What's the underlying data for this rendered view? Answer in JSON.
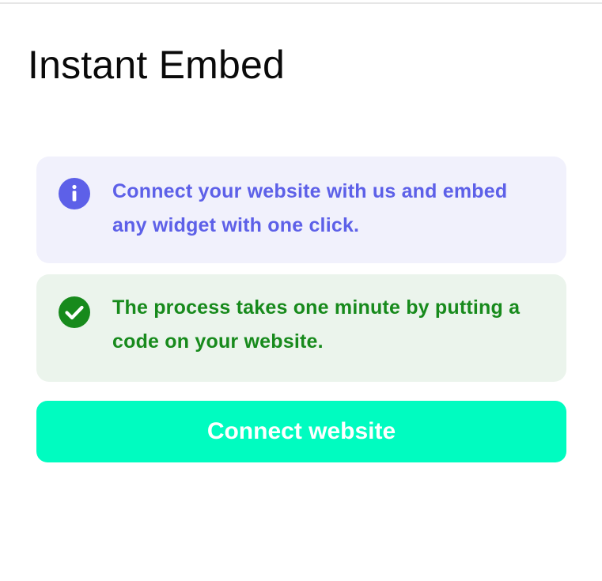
{
  "page": {
    "title": "Instant Embed"
  },
  "notices": {
    "info": {
      "icon": "info-icon",
      "color": "#5d60e8",
      "background": "#f1f1fc",
      "text": "Connect your website with us and embed any widget with one click."
    },
    "success": {
      "icon": "check-circle-icon",
      "color": "#178a1c",
      "background": "#ebf4ec",
      "text": "The process takes one minute by putting a code on your website."
    }
  },
  "actions": {
    "connect_label": "Connect website",
    "connect_color": "#00fcc0"
  }
}
